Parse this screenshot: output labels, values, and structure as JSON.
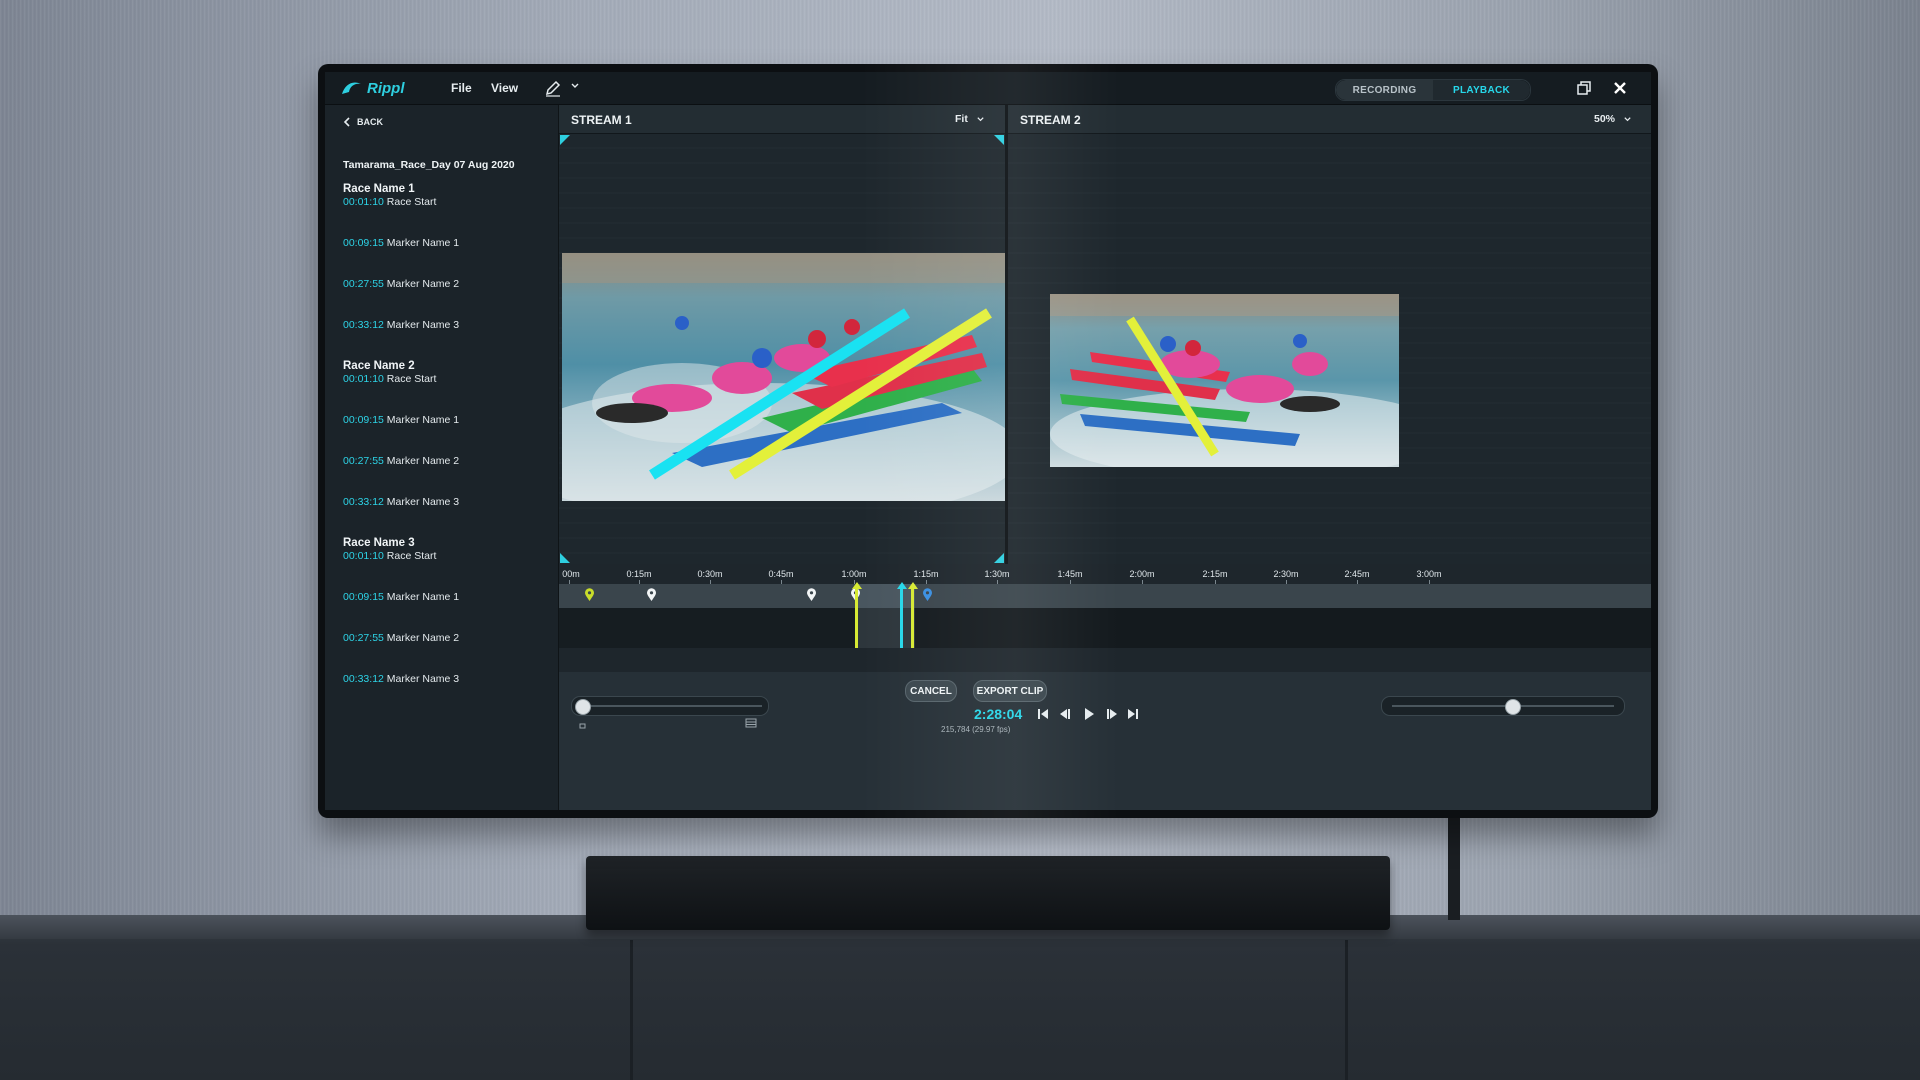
{
  "app": {
    "logo_text": "Rippl",
    "menu": {
      "file": "File",
      "view": "View"
    },
    "mode": {
      "recording": "RECORDING",
      "playback": "PLAYBACK",
      "active": "playback"
    },
    "accent_color": "#2ecfe0"
  },
  "sidebar": {
    "back_label": "BACK",
    "session_title": "Tamarama_Race_Day 07 Aug 2020",
    "races": [
      {
        "name": "Race Name 1",
        "markers": [
          {
            "time": "00:01:10",
            "label": "Race Start"
          },
          {
            "time": "00:09:15",
            "label": "Marker Name 1"
          },
          {
            "time": "00:27:55",
            "label": "Marker Name 2"
          },
          {
            "time": "00:33:12",
            "label": "Marker Name 3"
          }
        ]
      },
      {
        "name": "Race Name 2",
        "markers": [
          {
            "time": "00:01:10",
            "label": "Race Start"
          },
          {
            "time": "00:09:15",
            "label": "Marker Name 1"
          },
          {
            "time": "00:27:55",
            "label": "Marker Name 2"
          },
          {
            "time": "00:33:12",
            "label": "Marker Name 3"
          }
        ]
      },
      {
        "name": "Race Name 3",
        "markers": [
          {
            "time": "00:01:10",
            "label": "Race Start"
          },
          {
            "time": "00:09:15",
            "label": "Marker Name 1"
          },
          {
            "time": "00:27:55",
            "label": "Marker Name 2"
          },
          {
            "time": "00:33:12",
            "label": "Marker Name 3"
          }
        ]
      }
    ]
  },
  "streams": [
    {
      "title": "STREAM 1",
      "zoom": "Fit"
    },
    {
      "title": "STREAM 2",
      "zoom": "50%"
    }
  ],
  "timeline": {
    "ticks": [
      "00m",
      "0:15m",
      "0:30m",
      "0:45m",
      "1:00m",
      "1:15m",
      "1:30m",
      "1:45m",
      "2:00m",
      "2:15m",
      "2:30m",
      "2:45m",
      "3:00m"
    ]
  },
  "controls": {
    "cancel_label": "CANCEL",
    "export_label": "EXPORT CLIP",
    "timecode": "2:28:04",
    "frame_info": "215,784 (29.97 fps)"
  },
  "icons": [
    "pencil-icon",
    "chevron-down-icon",
    "restore-window-icon",
    "close-icon",
    "back-chevron-icon",
    "skip-start-icon",
    "step-back-icon",
    "play-icon",
    "step-forward-icon",
    "skip-end-icon",
    "map-pin-icon"
  ]
}
